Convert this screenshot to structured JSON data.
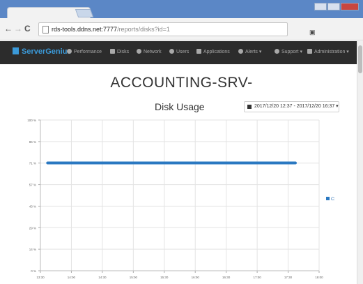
{
  "browser": {
    "tab_close": "×",
    "back": "←",
    "forward": "→",
    "reload": "C",
    "url_host": "rds-tools.ddns.net:7777",
    "url_path": "/reports/disks?id=1"
  },
  "navbar": {
    "brand": "ServerGenius",
    "items": [
      {
        "label": "Performance"
      },
      {
        "label": "Disks"
      },
      {
        "label": "Network"
      },
      {
        "label": "Users"
      },
      {
        "label": "Applications"
      },
      {
        "label": "Alerts ▾"
      },
      {
        "label": "Support ▾"
      },
      {
        "label": "Administration ▾"
      }
    ]
  },
  "page": {
    "title": "ACCOUNTING-SRV-",
    "chart_title": "Disk Usage",
    "date_range": "2017/12/20 12:37 - 2017/12/20 16:37 ▾"
  },
  "colors": {
    "series": "#2a78c1",
    "navbar": "#2c2c2c",
    "brand": "#3b9ad9"
  },
  "chart_data": {
    "type": "line",
    "title": "Disk Usage",
    "y_ticks": [
      "0 %",
      "14 %",
      "29 %",
      "43 %",
      "57 %",
      "71 %",
      "86 %",
      "100 %"
    ],
    "x_ticks": [
      "13:30",
      "14:00",
      "14:30",
      "15:00",
      "15:30",
      "16:00",
      "16:30",
      "17:00",
      "17:30",
      "18:00"
    ],
    "ylim": [
      0,
      100
    ],
    "xlim": [
      "13:30",
      "18:00"
    ],
    "series": [
      {
        "name": "C:",
        "x": [
          "13:37",
          "17:37"
        ],
        "y": [
          71.5,
          71.5
        ]
      }
    ],
    "grid": true,
    "legend_position": "right"
  }
}
